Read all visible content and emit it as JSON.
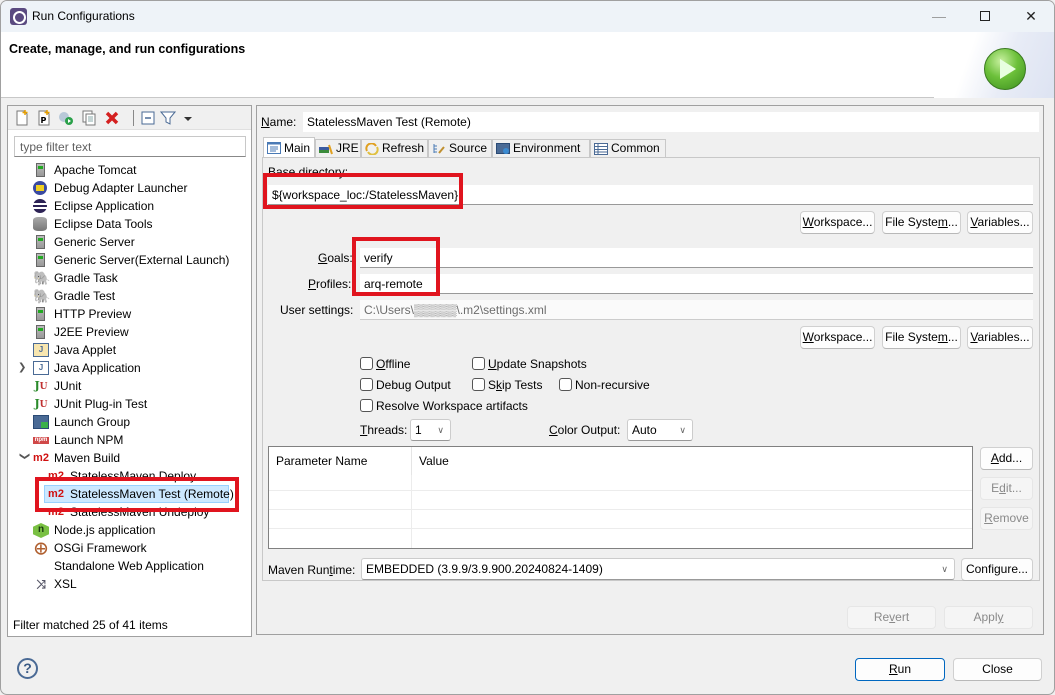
{
  "window": {
    "title": "Run Configurations",
    "controls": {
      "minimize": "—",
      "maximize": "□",
      "close": "✕"
    }
  },
  "banner": {
    "title": "Create, manage, and run configurations",
    "icon": "run-icon"
  },
  "left_panel": {
    "toolbar": [
      {
        "name": "new-configuration",
        "icon": "new-file-icon"
      },
      {
        "name": "new-prototype",
        "icon": "new-prototype-icon"
      },
      {
        "name": "export",
        "icon": "export-icon"
      },
      {
        "name": "duplicate",
        "icon": "duplicate-icon"
      },
      {
        "name": "delete",
        "icon": "delete-icon"
      },
      {
        "name": "collapse-all",
        "icon": "collapse-all-icon"
      },
      {
        "name": "filter",
        "icon": "filter-icon"
      },
      {
        "name": "view-menu",
        "icon": "dropdown-icon"
      }
    ],
    "filter_placeholder": "type filter text",
    "tree": [
      {
        "label": "Apache Tomcat",
        "icon": "server-icon",
        "level": 0
      },
      {
        "label": "Debug Adapter Launcher",
        "icon": "debug-adapter-icon",
        "level": 0
      },
      {
        "label": "Eclipse Application",
        "icon": "eclipse-icon",
        "level": 0
      },
      {
        "label": "Eclipse Data Tools",
        "icon": "database-icon",
        "level": 0
      },
      {
        "label": "Generic Server",
        "icon": "server-icon",
        "level": 0
      },
      {
        "label": "Generic Server(External Launch)",
        "icon": "server-icon",
        "level": 0
      },
      {
        "label": "Gradle Task",
        "icon": "gradle-elephant-dark-icon",
        "level": 0
      },
      {
        "label": "Gradle Test",
        "icon": "gradle-elephant-light-icon",
        "level": 0
      },
      {
        "label": "HTTP Preview",
        "icon": "server-icon",
        "level": 0
      },
      {
        "label": "J2EE Preview",
        "icon": "server-icon",
        "level": 0
      },
      {
        "label": "Java Applet",
        "icon": "java-applet-icon",
        "level": 0
      },
      {
        "label": "Java Application",
        "icon": "java-application-icon",
        "level": 0,
        "expandable": true,
        "expanded": false
      },
      {
        "label": "JUnit",
        "icon": "junit-icon",
        "level": 0
      },
      {
        "label": "JUnit Plug-in Test",
        "icon": "junit-plugin-icon",
        "level": 0
      },
      {
        "label": "Launch Group",
        "icon": "launch-group-icon",
        "level": 0
      },
      {
        "label": "Launch NPM",
        "icon": "npm-icon",
        "level": 0
      },
      {
        "label": "Maven Build",
        "icon": "m2-icon",
        "level": 0,
        "expandable": true,
        "expanded": true
      },
      {
        "label": "StatelessMaven Deploy",
        "icon": "m2-icon",
        "level": 1
      },
      {
        "label": "StatelessMaven Test (Remote)",
        "icon": "m2-icon",
        "level": 1,
        "selected": true
      },
      {
        "label": "StatelessMaven Undeploy",
        "icon": "m2-icon",
        "level": 1
      },
      {
        "label": "Node.js application",
        "icon": "nodejs-icon",
        "level": 0
      },
      {
        "label": "OSGi Framework",
        "icon": "osgi-icon",
        "level": 0
      },
      {
        "label": "Standalone Web Application",
        "icon": "",
        "level": 0
      },
      {
        "label": "XSL",
        "icon": "xsl-icon",
        "level": 0
      }
    ],
    "status": "Filter matched 25 of 41 items"
  },
  "config": {
    "name_label": "Name:",
    "name_value": "StatelessMaven Test (Remote)",
    "tabs": [
      {
        "label": "Main",
        "icon": "main-tab-icon",
        "active": true
      },
      {
        "label": "JRE",
        "icon": "jre-icon"
      },
      {
        "label": "Refresh",
        "icon": "refresh-icon"
      },
      {
        "label": "Source",
        "icon": "source-icon"
      },
      {
        "label": "Environment",
        "icon": "environment-icon"
      },
      {
        "label": "Common",
        "icon": "common-icon"
      }
    ],
    "main": {
      "base_dir_label": "Base directory:",
      "base_dir_value": "${workspace_loc:/StatelessMaven}",
      "buttons_row1": [
        "Workspace...",
        "File System...",
        "Variables..."
      ],
      "goals_label": "Goals:",
      "goals_value": "verify",
      "profiles_label": "Profiles:",
      "profiles_value": "arq-remote",
      "user_settings_label": "User settings:",
      "user_settings_value": "C:\\Users\\▒▒▒▒▒\\.m2\\settings.xml",
      "buttons_row2": [
        "Workspace...",
        "File System...",
        "Variables..."
      ],
      "checkboxes": [
        {
          "label": "Offline",
          "checked": false
        },
        {
          "label": "Update Snapshots",
          "checked": false
        },
        {
          "label": "Debug Output",
          "checked": false
        },
        {
          "label": "Skip Tests",
          "checked": false
        },
        {
          "label": "Non-recursive",
          "checked": false
        },
        {
          "label": "Resolve Workspace artifacts",
          "checked": false
        }
      ],
      "threads_label": "Threads:",
      "threads_value": "1",
      "color_output_label": "Color Output:",
      "color_output_value": "Auto",
      "param_table": {
        "columns": [
          "Parameter Name",
          "Value"
        ],
        "rows": []
      },
      "param_buttons": {
        "add": "Add...",
        "edit": "Edit...",
        "remove": "Remove"
      },
      "runtime_label": "Maven Runtime:",
      "runtime_value": "EMBEDDED (3.9.9/3.9.900.20240824-1409)",
      "configure_label": "Configure..."
    },
    "revert_label": "Revert",
    "apply_label": "Apply"
  },
  "footer": {
    "run_label": "Run",
    "close_label": "Close",
    "help_icon": "?"
  },
  "annotations": {
    "highlight_color": "#e0141e"
  }
}
